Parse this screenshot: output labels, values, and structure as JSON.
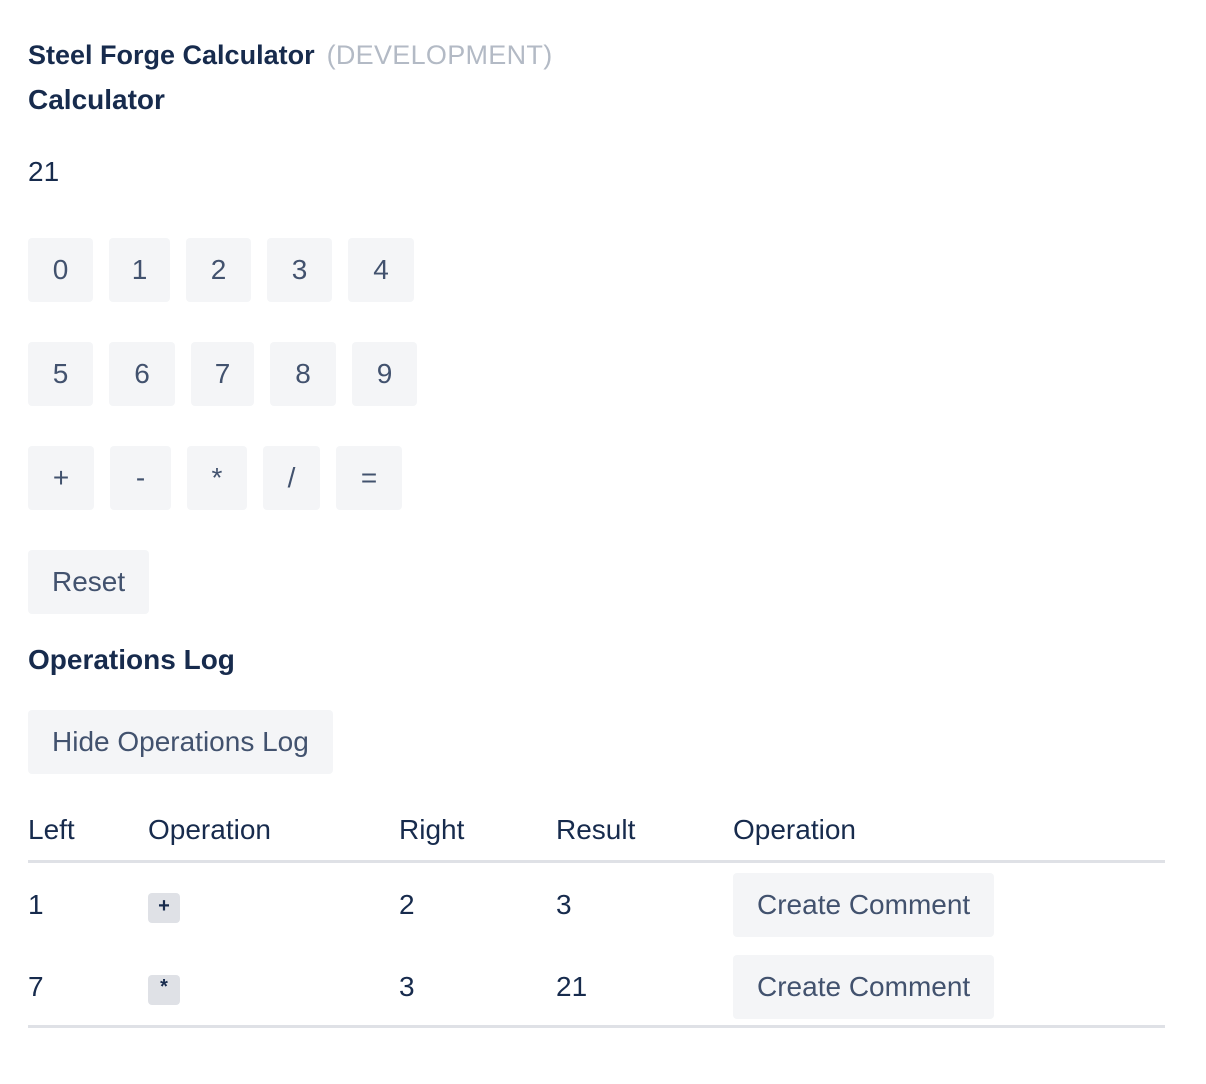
{
  "header": {
    "app_title": "Steel Forge Calculator",
    "environment": "(DEVELOPMENT)"
  },
  "calculator": {
    "heading": "Calculator",
    "display_value": "21",
    "digit_rows": [
      [
        "0",
        "1",
        "2",
        "3",
        "4"
      ],
      [
        "5",
        "6",
        "7",
        "8",
        "9"
      ]
    ],
    "operators": [
      "+",
      "-",
      "*",
      "/",
      "="
    ],
    "reset_label": "Reset"
  },
  "operations_log": {
    "heading": "Operations Log",
    "toggle_label": "Hide Operations Log",
    "columns": [
      "Left",
      "Operation",
      "Right",
      "Result",
      "Operation"
    ],
    "rows": [
      {
        "left": "1",
        "operation": "+",
        "right": "2",
        "result": "3",
        "action_label": "Create Comment"
      },
      {
        "left": "7",
        "operation": "*",
        "right": "3",
        "result": "21",
        "action_label": "Create Comment"
      }
    ]
  },
  "colors": {
    "text_primary": "#172b4d",
    "text_muted": "#b3bac5",
    "button_bg": "#f4f5f7",
    "button_text": "#42526e",
    "rule": "#dfe1e6"
  }
}
